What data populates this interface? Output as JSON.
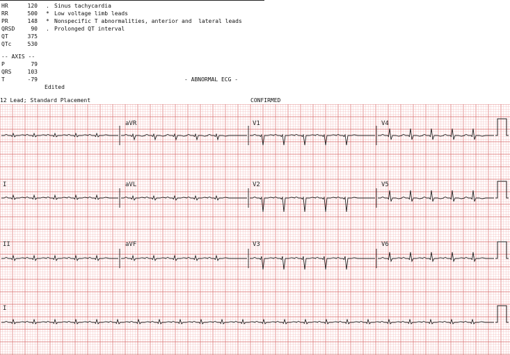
{
  "measurements": [
    {
      "label": "HR",
      "value": "120"
    },
    {
      "label": "RR",
      "value": "500"
    },
    {
      "label": "PR",
      "value": "148"
    },
    {
      "label": "QRSD",
      "value": "90"
    },
    {
      "label": "QT",
      "value": "375"
    },
    {
      "label": "QTc",
      "value": "530"
    }
  ],
  "interpretation": [
    {
      "marker": ".",
      "text": "Sinus tachycardia"
    },
    {
      "marker": "*",
      "text": "Low voltage limb leads"
    },
    {
      "marker": "*",
      "text": "Nonspecific T abnormalities, anterior and  lateral leads"
    },
    {
      "marker": ".",
      "text": "Prolonged QT interval"
    }
  ],
  "axis": {
    "header": "-- AXIS --",
    "rows": [
      {
        "label": "P",
        "value": "79"
      },
      {
        "label": "QRS",
        "value": "103"
      },
      {
        "label": "T",
        "value": "-79"
      }
    ]
  },
  "status": {
    "edited": "Edited",
    "abnormal": "- ABNORMAL ECG -",
    "placement": "12 Lead; Standard Placement",
    "confirmed": "CONFIRMED"
  },
  "leads": [
    [
      "",
      "aVR",
      "V1",
      "V4"
    ],
    [
      "I",
      "aVL",
      "V2",
      "V5"
    ],
    [
      "II",
      "aVF",
      "V3",
      "V6"
    ],
    [
      "I"
    ]
  ],
  "colors": {
    "grid_minor": "#f2b3b3",
    "grid_major": "#d96a6a",
    "trace": "#222222"
  }
}
